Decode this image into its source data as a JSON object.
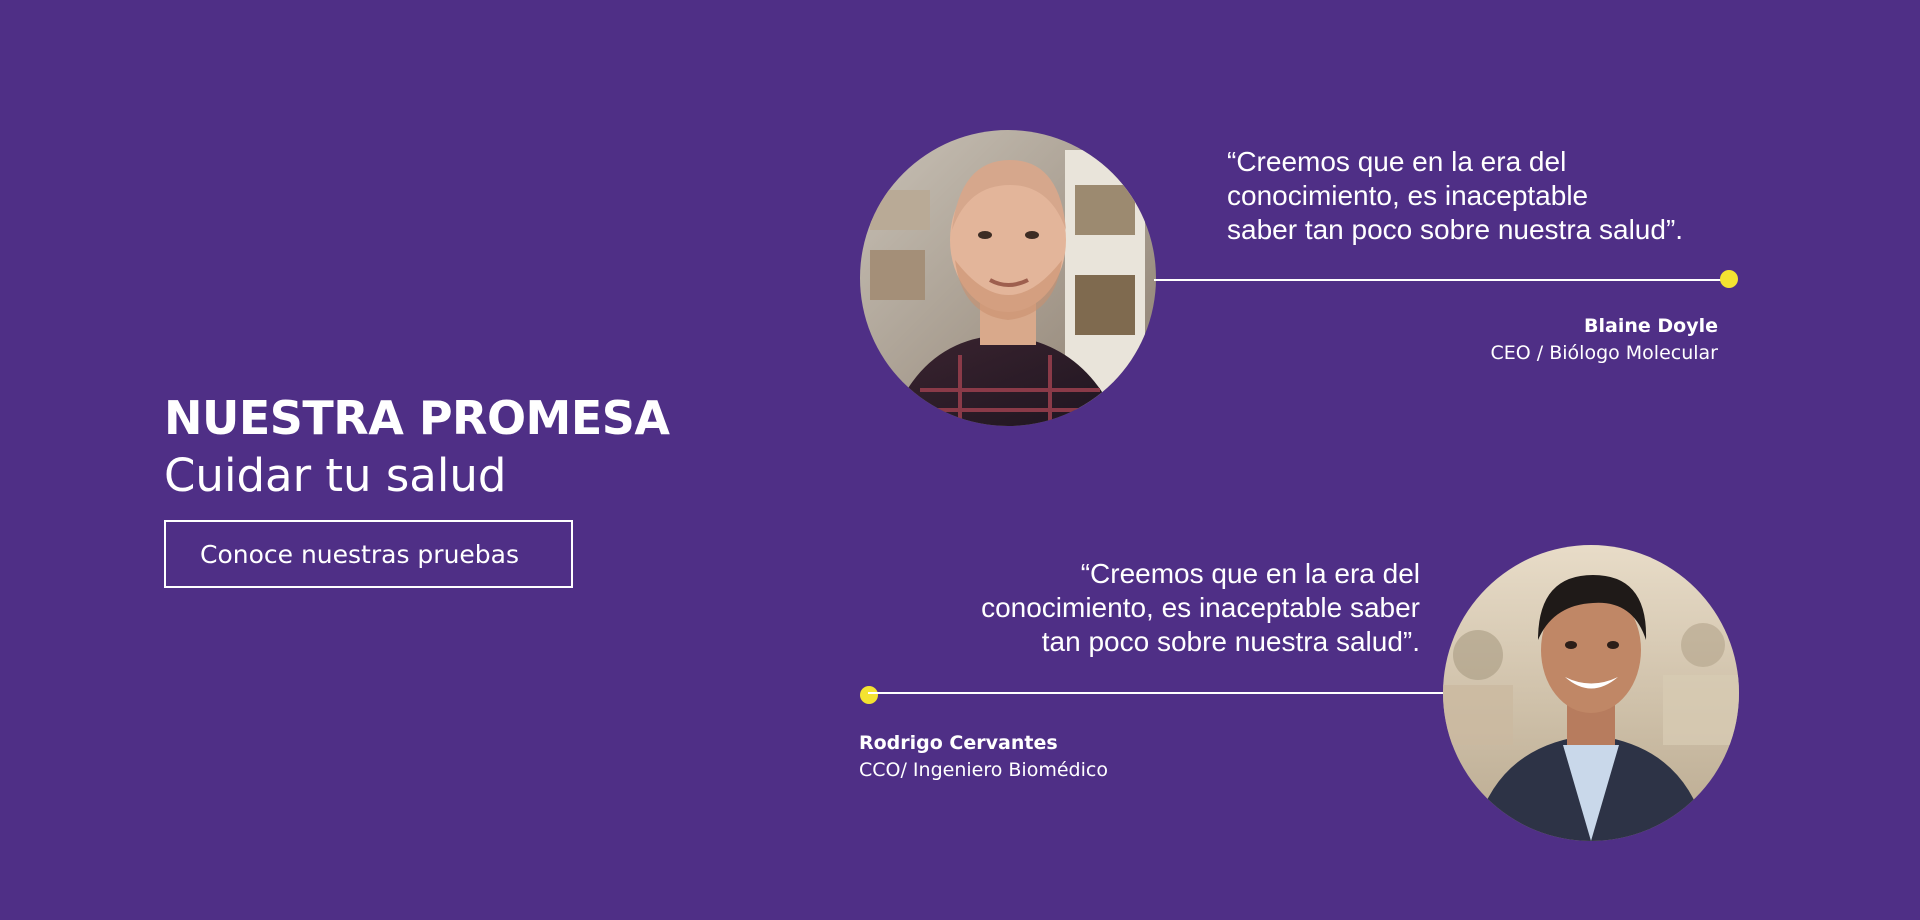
{
  "colors": {
    "background": "#4f2f86",
    "text": "#ffffff",
    "accent_dot": "#f4e331"
  },
  "hero": {
    "title": "NUESTRA PROMESA",
    "subtitle": "Cuidar tu salud",
    "cta_label": "Conoce nuestras pruebas"
  },
  "testimonials": [
    {
      "quote_lines": [
        "“Creemos que en la era del",
        "conocimiento, es inaceptable",
        "saber tan poco sobre nuestra salud”."
      ],
      "name": "Blaine Doyle",
      "role": "CEO / Biólogo Molecular",
      "photo_icon": "portrait-photo"
    },
    {
      "quote_lines": [
        "“Creemos que en la era del",
        "conocimiento, es inaceptable saber",
        "tan poco sobre nuestra salud”."
      ],
      "name": "Rodrigo Cervantes",
      "role": "CCO/ Ingeniero Biomédico",
      "photo_icon": "portrait-photo"
    }
  ]
}
